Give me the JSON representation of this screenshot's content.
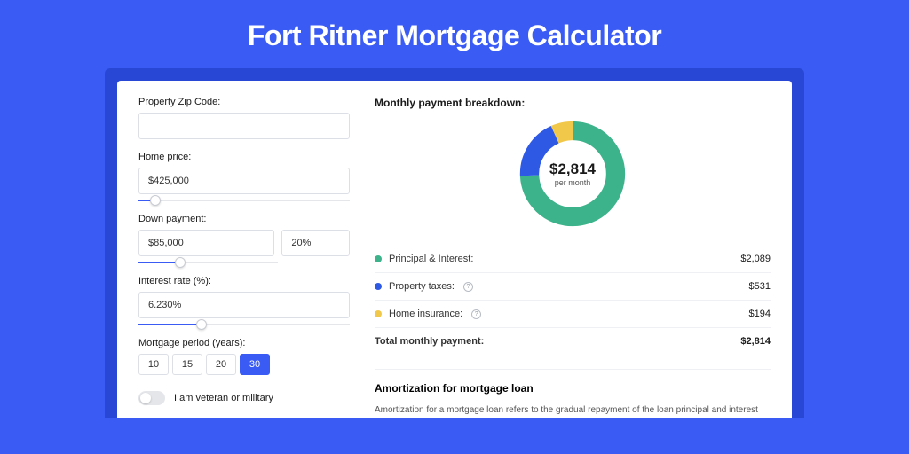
{
  "page_title": "Fort Ritner Mortgage Calculator",
  "form": {
    "zip": {
      "label": "Property Zip Code:",
      "value": ""
    },
    "price": {
      "label": "Home price:",
      "value": "$425,000",
      "slider_pct": 8
    },
    "down": {
      "label": "Down payment:",
      "amount": "$85,000",
      "pct": "20%",
      "slider_pct": 20
    },
    "rate": {
      "label": "Interest rate (%):",
      "value": "6.230%",
      "slider_pct": 30
    },
    "period": {
      "label": "Mortgage period (years):",
      "options": [
        "10",
        "15",
        "20",
        "30"
      ],
      "selected": "30"
    },
    "veteran": {
      "label": "I am veteran or military",
      "on": false
    }
  },
  "breakdown": {
    "title": "Monthly payment breakdown:",
    "center_amount": "$2,814",
    "center_sub": "per month",
    "rows": [
      {
        "label": "Principal & Interest:",
        "value": "$2,089",
        "color": "#3cb38a",
        "info": false
      },
      {
        "label": "Property taxes:",
        "value": "$531",
        "color": "#2e59e5",
        "info": true
      },
      {
        "label": "Home insurance:",
        "value": "$194",
        "color": "#f2c84b",
        "info": true
      }
    ],
    "total": {
      "label": "Total monthly payment:",
      "value": "$2,814"
    }
  },
  "amort": {
    "title": "Amortization for mortgage loan",
    "text": "Amortization for a mortgage loan refers to the gradual repayment of the loan principal and interest over a specified"
  },
  "chart_data": {
    "type": "pie",
    "title": "Monthly payment breakdown",
    "series": [
      {
        "name": "Principal & Interest",
        "value": 2089,
        "color": "#3cb38a"
      },
      {
        "name": "Property taxes",
        "value": 531,
        "color": "#2e59e5"
      },
      {
        "name": "Home insurance",
        "value": 194,
        "color": "#f2c84b"
      }
    ],
    "total": 2814
  }
}
